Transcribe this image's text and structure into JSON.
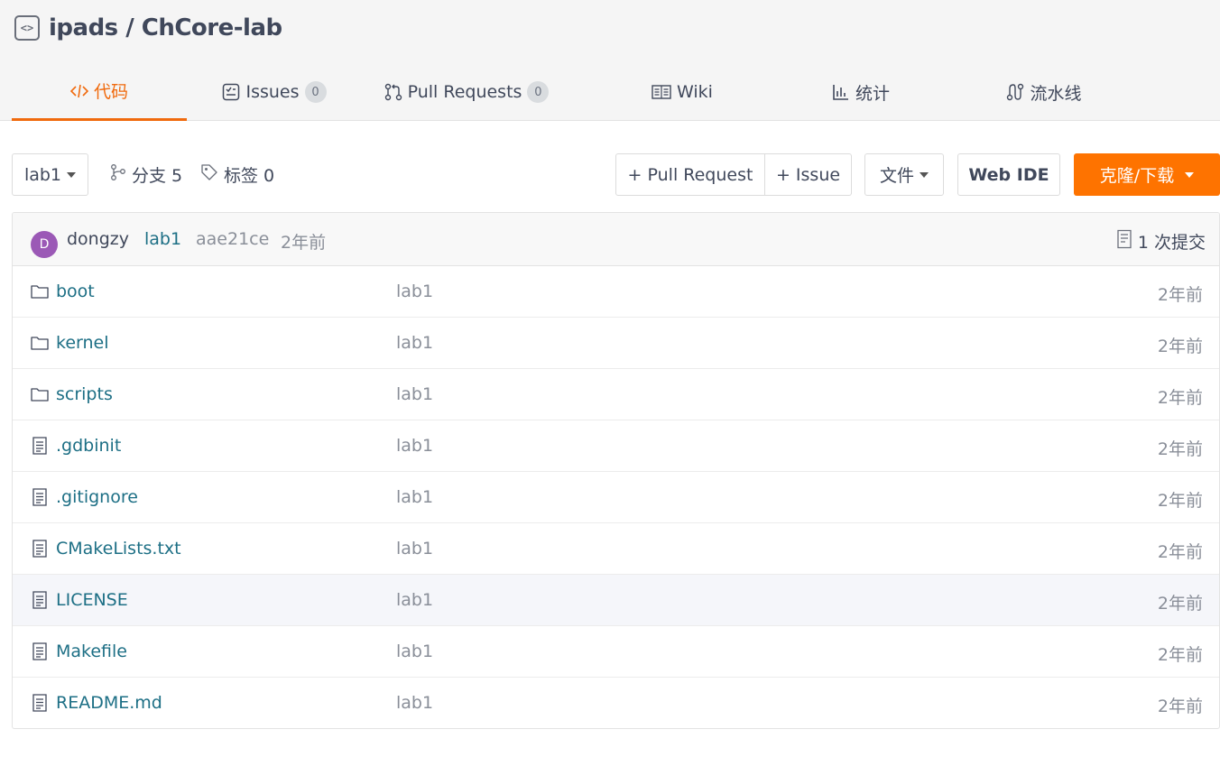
{
  "repo": {
    "owner": "ipads",
    "separator": "/",
    "name": "ChCore-lab",
    "title": "ipads / ChCore-lab",
    "icon": "code-icon"
  },
  "tabs": [
    {
      "label": "代码",
      "icon": "code-icon",
      "active": true
    },
    {
      "label": "Issues",
      "icon": "issues-icon",
      "badge": "0"
    },
    {
      "label": "Pull Requests",
      "icon": "pull-request-icon",
      "badge": "0"
    },
    {
      "label": "Wiki",
      "icon": "book-icon"
    },
    {
      "label": "统计",
      "icon": "chart-icon"
    },
    {
      "label": "流水线",
      "icon": "pipeline-icon"
    }
  ],
  "toolbar": {
    "branch": "lab1",
    "branches_label": "分支 5",
    "tags_label": "标签 0",
    "pull_request_label": "+ Pull Request",
    "issue_label": "+ Issue",
    "file_label": "文件",
    "web_ide_label": "Web IDE",
    "clone_label": "克隆/下载"
  },
  "commit": {
    "avatar_letter": "D",
    "author": "dongzy",
    "branch": "lab1",
    "sha": "aae21ce",
    "time": "2年前",
    "count_label": "1 次提交"
  },
  "files": [
    {
      "name": "boot",
      "type": "folder",
      "message": "lab1",
      "time": "2年前"
    },
    {
      "name": "kernel",
      "type": "folder",
      "message": "lab1",
      "time": "2年前"
    },
    {
      "name": "scripts",
      "type": "folder",
      "message": "lab1",
      "time": "2年前"
    },
    {
      "name": ".gdbinit",
      "type": "file",
      "message": "lab1",
      "time": "2年前"
    },
    {
      "name": ".gitignore",
      "type": "file",
      "message": "lab1",
      "time": "2年前"
    },
    {
      "name": "CMakeLists.txt",
      "type": "file",
      "message": "lab1",
      "time": "2年前"
    },
    {
      "name": "LICENSE",
      "type": "file",
      "message": "lab1",
      "time": "2年前"
    },
    {
      "name": "Makefile",
      "type": "file",
      "message": "lab1",
      "time": "2年前"
    },
    {
      "name": "README.md",
      "type": "file",
      "message": "lab1",
      "time": "2年前"
    }
  ],
  "colors": {
    "accent": "#f06a0d",
    "clone_button": "#fe7300",
    "link": "#1d6f85",
    "avatar": "#9b59b6"
  }
}
